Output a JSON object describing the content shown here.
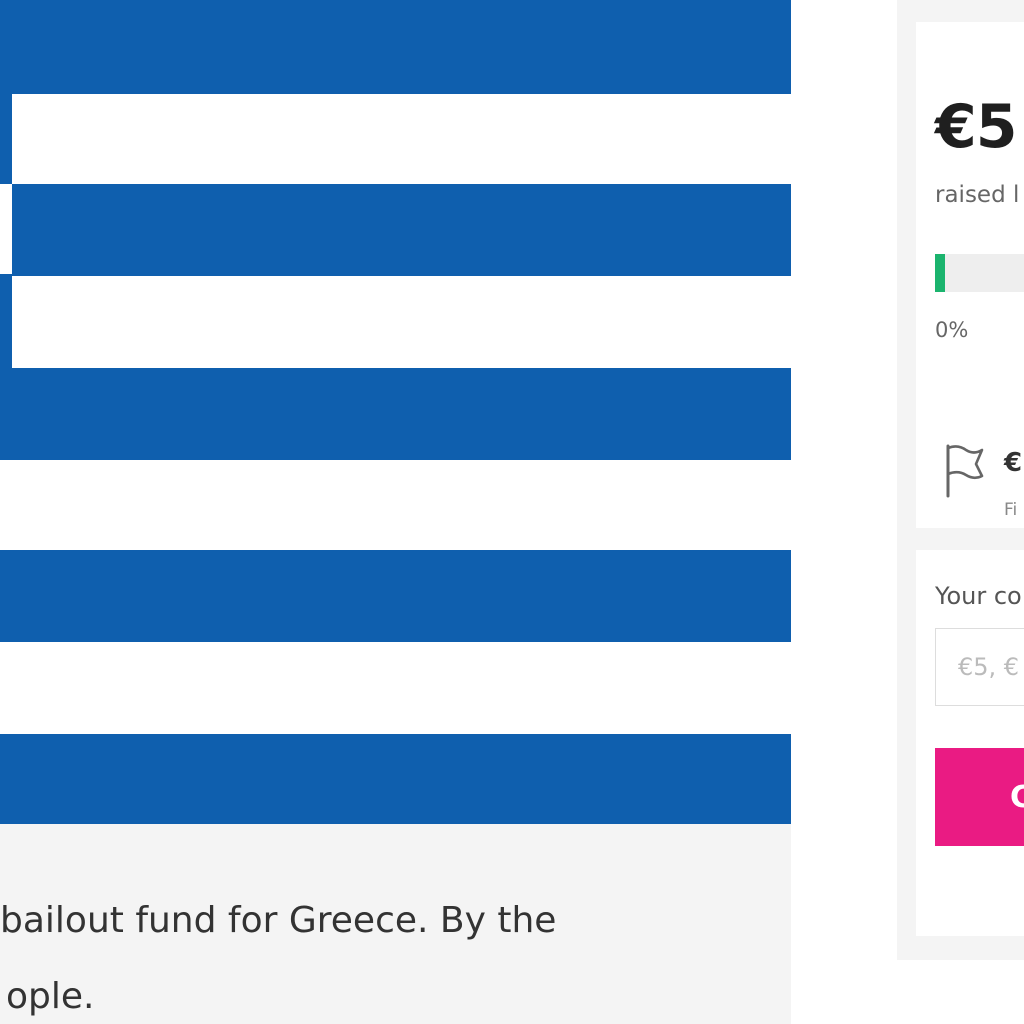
{
  "campaign": {
    "description_lines": [
      "bailout fund for Greece. By the",
      "ople."
    ]
  },
  "summary": {
    "amount": "€5",
    "raised_label": "raised l",
    "progress_fraction": 0.01,
    "percent_label": "0%",
    "goal_amount": "€",
    "goal_label": "Fi"
  },
  "contribute": {
    "label": "Your co",
    "placeholder": "€5, €",
    "button_label": "C"
  },
  "colors": {
    "flag_blue": "#0f5fae",
    "progress_green": "#1bb46e",
    "button_pink": "#ea1b83"
  },
  "icons": {
    "goal": "flag-icon"
  }
}
